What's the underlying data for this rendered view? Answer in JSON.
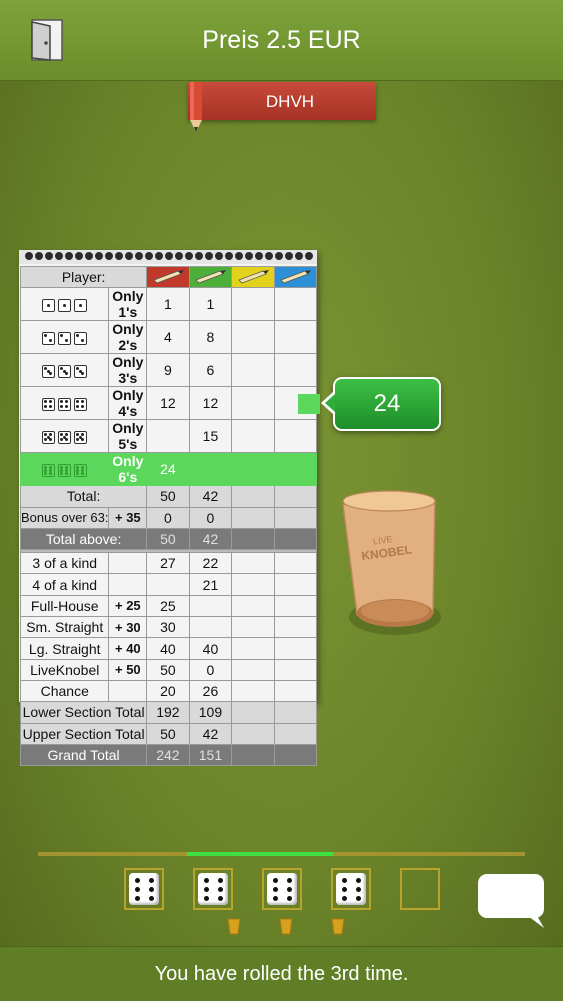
{
  "header": {
    "title": "Preis 2.5 EUR",
    "exit_icon": "door-exit-icon"
  },
  "player_tab": {
    "label": "DHVH",
    "color": "#b33a2b"
  },
  "scorecard": {
    "header_label": "Player:",
    "player_colors": [
      "#c0392b",
      "#4caf3a",
      "#e3d21c",
      "#2d8fd5"
    ],
    "upper": [
      {
        "label": "Only 1's",
        "face": 1,
        "p1": "1",
        "p2": "1"
      },
      {
        "label": "Only 2's",
        "face": 2,
        "p1": "4",
        "p2": "8"
      },
      {
        "label": "Only 3's",
        "face": 3,
        "p1": "9",
        "p2": "6"
      },
      {
        "label": "Only 4's",
        "face": 4,
        "p1": "12",
        "p2": "12"
      },
      {
        "label": "Only 5's",
        "face": 5,
        "p1": "",
        "p2": "15"
      },
      {
        "label": "Only 6's",
        "face": 6,
        "p1": "24",
        "p2": "",
        "highlight": true
      }
    ],
    "total": {
      "label": "Total:",
      "p1": "50",
      "p2": "42"
    },
    "bonus": {
      "label": "Bonus over 63:",
      "points": "+ 35",
      "p1": "0",
      "p2": "0"
    },
    "total_above": {
      "label": "Total above:",
      "p1": "50",
      "p2": "42"
    },
    "lower": [
      {
        "label": "3 of a kind",
        "points": "",
        "p1": "27",
        "p2": "22"
      },
      {
        "label": "4 of a kind",
        "points": "",
        "p1": "",
        "p2": "21"
      },
      {
        "label": "Full-House",
        "points": "+ 25",
        "p1": "25",
        "p2": ""
      },
      {
        "label": "Sm. Straight",
        "points": "+ 30",
        "p1": "30",
        "p2": ""
      },
      {
        "label": "Lg. Straight",
        "points": "+ 40",
        "p1": "40",
        "p2": "40"
      },
      {
        "label": "LiveKnobel",
        "points": "+ 50",
        "p1": "50",
        "p2": "0"
      },
      {
        "label": "Chance",
        "points": "",
        "p1": "20",
        "p2": "26"
      }
    ],
    "lower_total": {
      "label": "Lower Section Total",
      "p1": "192",
      "p2": "109"
    },
    "upper_total": {
      "label": "Upper Section Total",
      "p1": "50",
      "p2": "42"
    },
    "grand_total": {
      "label": "Grand Total",
      "p1": "242",
      "p2": "151"
    }
  },
  "badge": {
    "value": "24"
  },
  "rolls": {
    "progress_fraction": 0.3
  },
  "dice_tray": [
    6,
    6,
    6,
    6,
    0
  ],
  "status_text": "You have rolled the 3rd time."
}
